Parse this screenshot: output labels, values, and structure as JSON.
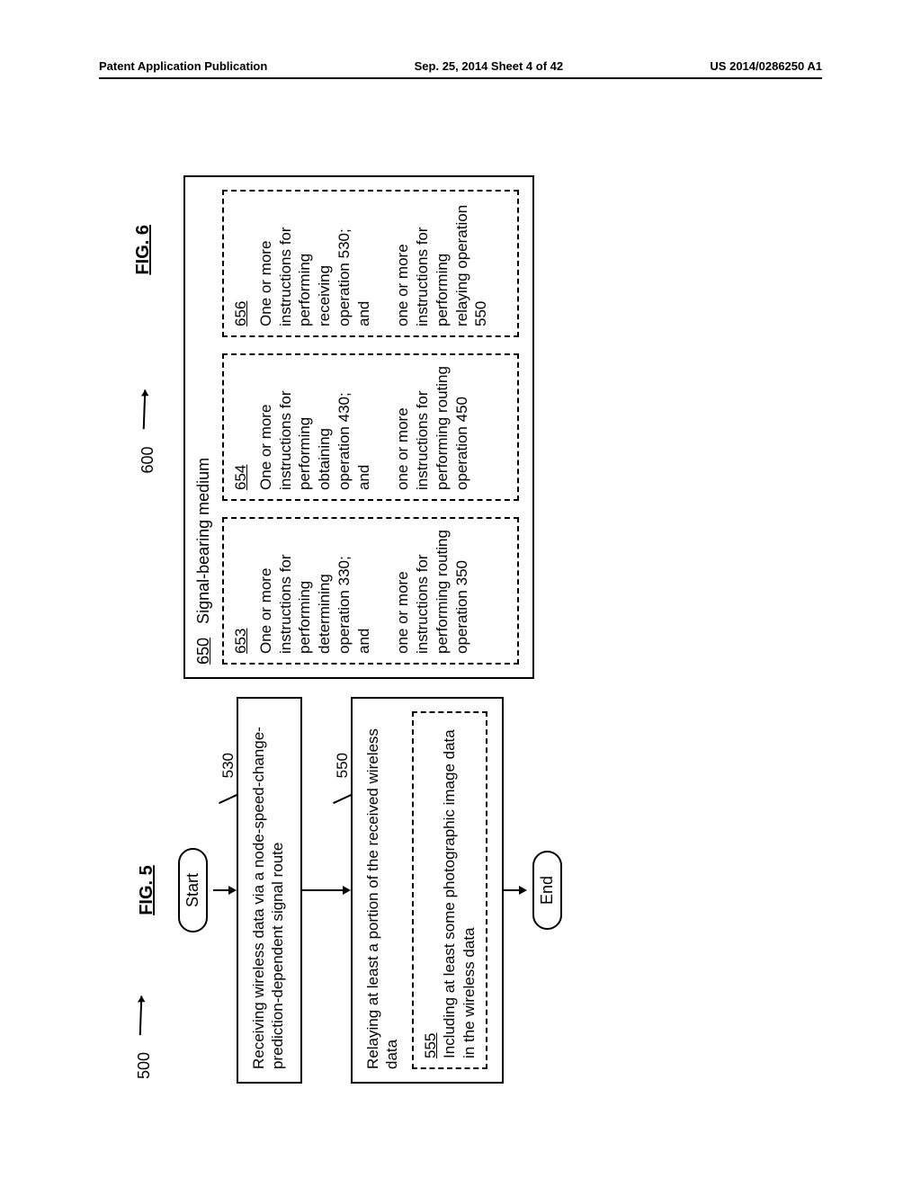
{
  "header": {
    "left": "Patent Application Publication",
    "center": "Sep. 25, 2014  Sheet 4 of 42",
    "right": "US 2014/0286250 A1"
  },
  "fig5": {
    "title": "FIG. 5",
    "ref": "500",
    "start": "Start",
    "end": "End",
    "step530_num": "530",
    "step530_text": "Receiving wireless data via a node-speed-change-prediction-dependent signal route",
    "step550_num": "550",
    "step550_text": "Relaying at least a portion of the received wireless data",
    "sub555_num": "555",
    "sub555_text": "Including at least some photographic image data in the wireless data"
  },
  "fig6": {
    "title": "FIG. 6",
    "ref": "600",
    "medium_num": "650",
    "medium_label": "Signal-bearing medium",
    "col653": {
      "num": "653",
      "p1": "One or more instructions for performing determining operation 330; and",
      "p2": "one or more instructions for performing routing operation 350"
    },
    "col654": {
      "num": "654",
      "p1": "One or more instructions for performing obtaining operation 430; and",
      "p2": "one or more instructions for performing routing operation 450"
    },
    "col656": {
      "num": "656",
      "p1": "One or more instructions for performing receiving operation 530; and",
      "p2": "one or more instructions for performing relaying operation 550"
    }
  }
}
